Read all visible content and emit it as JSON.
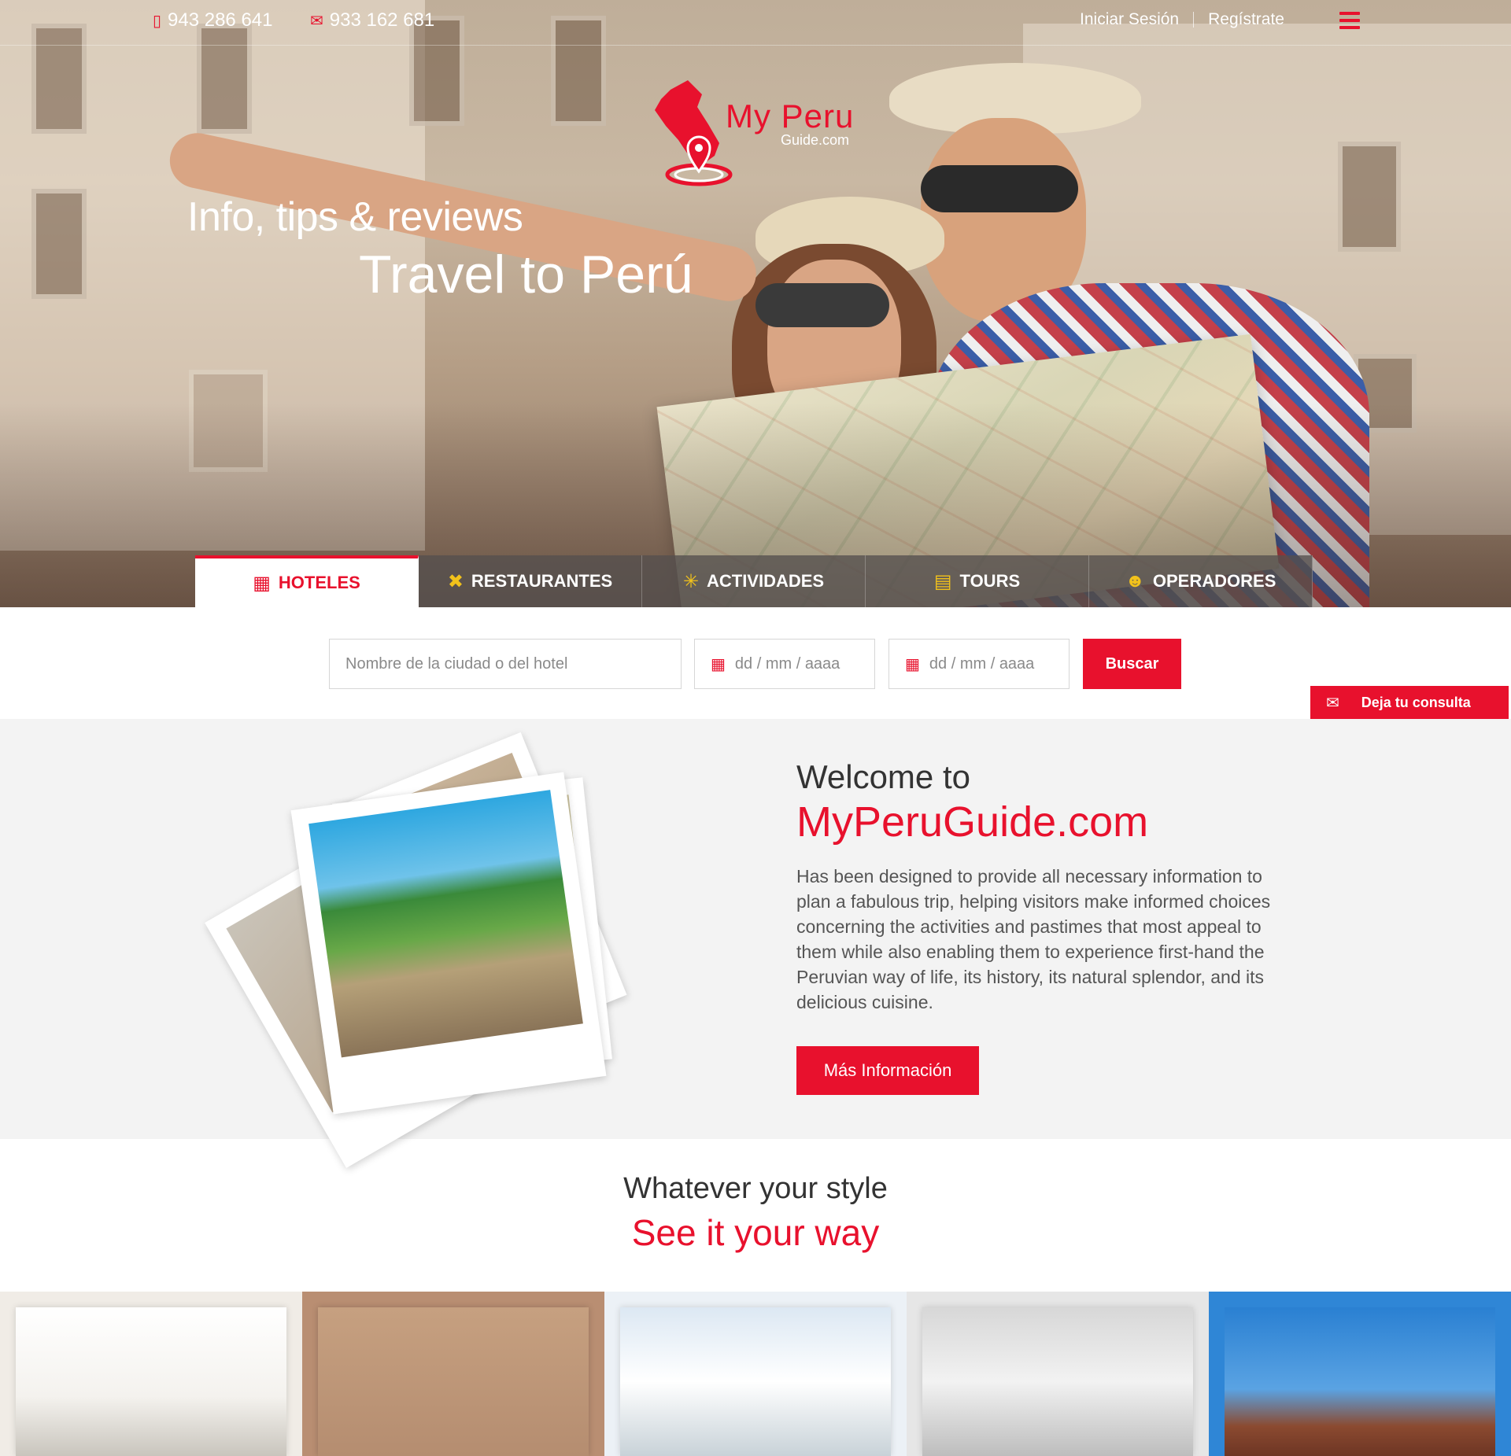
{
  "header": {
    "phone": "943 286 641",
    "email_phone": "933 162 681",
    "login": "Iniciar Sesión",
    "register": "Regístrate"
  },
  "logo": {
    "brand": "My Peru",
    "sub": "Guide.com"
  },
  "hero": {
    "tagline": "Info, tips & reviews",
    "headline": "Travel to Perú"
  },
  "tabs": [
    {
      "label": "HOTELES",
      "icon": "hotel-icon",
      "active": true
    },
    {
      "label": "RESTAURANTES",
      "icon": "cutlery-icon",
      "active": false
    },
    {
      "label": "ACTIVIDADES",
      "icon": "hiker-icon",
      "active": false
    },
    {
      "label": "TOURS",
      "icon": "map-icon",
      "active": false
    },
    {
      "label": "OPERADORES",
      "icon": "operator-icon",
      "active": false
    }
  ],
  "search": {
    "city_placeholder": "Nombre de la ciudad o del hotel",
    "date_in_placeholder": "dd / mm / aaaa",
    "date_out_placeholder": "dd / mm / aaaa",
    "button": "Buscar"
  },
  "consulta": "Deja tu consulta",
  "welcome": {
    "title": "Welcome to",
    "site": "MyPeruGuide.com",
    "body": "Has been designed to provide all necessary information to plan a fabulous trip, helping visitors make informed choices concerning the activities and pastimes that most appeal to them while also enabling them to experience first-hand the Peruvian way of life, its history, its natural splendor, and its delicious cuisine.",
    "button": "Más Información"
  },
  "style_section": {
    "title": "Whatever your style",
    "subtitle": "See it your way"
  },
  "colors": {
    "accent": "#e8112d",
    "tab_icon": "#f2c21b"
  }
}
